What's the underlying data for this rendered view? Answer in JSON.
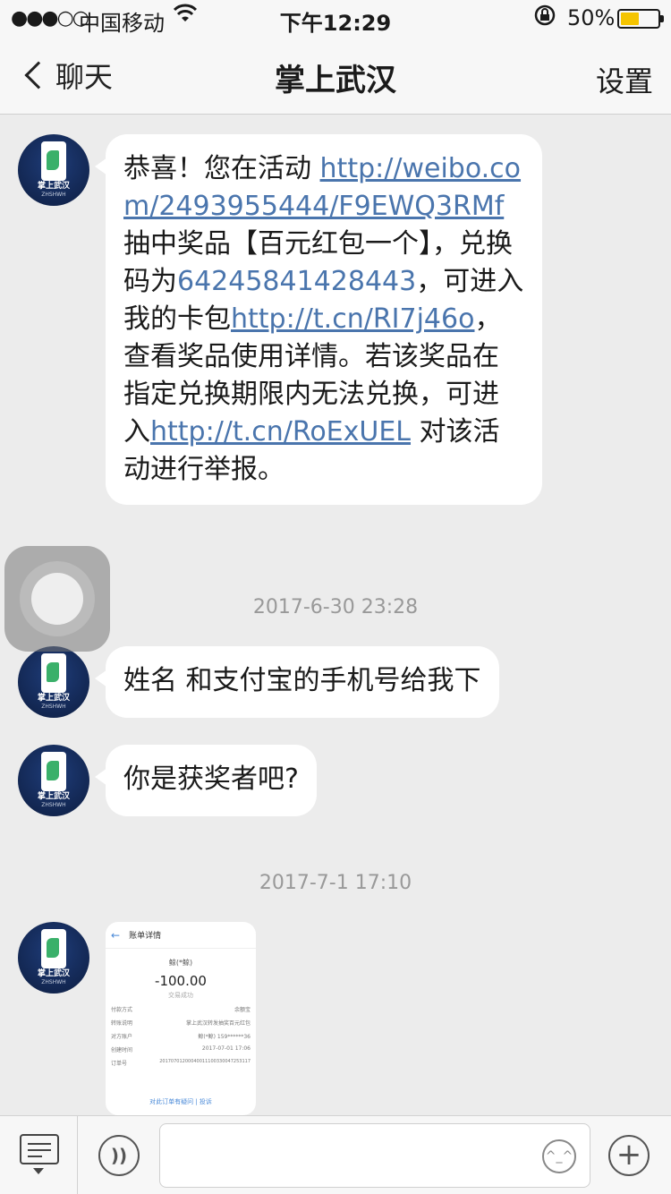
{
  "status_bar": {
    "signal": "●●●○○",
    "carrier": "中国移动",
    "time": "下午12:29",
    "battery": "50%",
    "battery_level": 0.5
  },
  "nav": {
    "back_label": "聊天",
    "title": "掌上武汉",
    "settings_label": "设置"
  },
  "avatar": {
    "text": "掌上武汉",
    "subtext": "ZHSHWH"
  },
  "messages": {
    "m1": {
      "p1": "恭喜！您在活动 ",
      "link1": "http://weibo.com/2493955444/F9EWQ3RMf",
      "p2": " 抽中奖品【百元红包一个】，兑换码为",
      "code": "64245841428443",
      "p3": "，可进入我的卡包",
      "link2": "http://t.cn/RI7j46o",
      "p4": "，查看奖品使用详情。若该奖品在指定兑换期限内无法兑换，可进入",
      "link3": "http://t.cn/RoExUEL",
      "p5": " 对该活动进行举报。"
    },
    "ts1": "2017-6-30 23:28",
    "m2": "姓名 和支付宝的手机号给我下",
    "m3": "你是获奖者吧?",
    "ts2": "2017-7-1 17:10"
  },
  "image_message": {
    "header": "账单详情",
    "user": "鲸(*鲸)",
    "amount": "-100.00",
    "status": "交易成功",
    "rows": [
      {
        "label": "付款方式",
        "value": "余额宝"
      },
      {
        "label": "转账说明",
        "value": "掌上武汉转发抽奖百元红包"
      },
      {
        "label": "对方账户",
        "value": "鲸(*鲸) 159******36"
      },
      {
        "label": "创建时间",
        "value": "2017-07-01 17:06"
      },
      {
        "label": "订单号",
        "value": "20170701200040011100330047253117"
      }
    ],
    "footer": "对此订单有疑问 | 投诉"
  },
  "toolbar": {
    "voice_glyph": "))",
    "emoji_glyph": "^_^",
    "plus_glyph": "+",
    "input_value": ""
  }
}
